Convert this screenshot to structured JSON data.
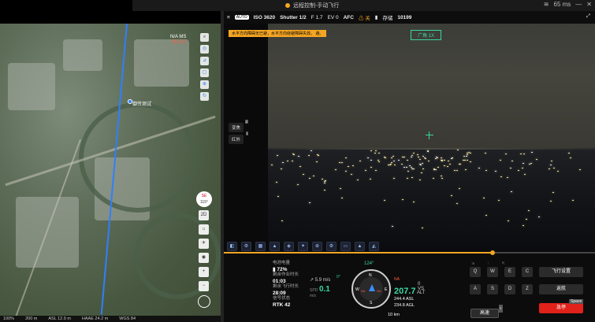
{
  "titlebar": {
    "title": "远程控制-手动飞行",
    "latency": "65 ms",
    "win_controls": [
      "—",
      "✕"
    ]
  },
  "map": {
    "route_label": "御传测试",
    "na_label": "N/A MS",
    "na_label2": "55.1Fs",
    "compass_label": "SE",
    "compass_deg": "115°",
    "tool_2d": "2D",
    "zoom_in": "+",
    "zoom_out": "−",
    "status": {
      "scale": "100%",
      "distance": "200 m",
      "asl": "ASL 12.9 m",
      "haae": "HAAE 24.2 m",
      "wgs": "WGS 84"
    }
  },
  "camera_bar": {
    "iso": "ISO 3620",
    "shutter": "Shutter 1/2",
    "fstop": "F 1.7",
    "ev": "EV 0",
    "af": "AFC",
    "warn_label": "⚠ 关",
    "storage_label": "存储",
    "storage_value": "10199"
  },
  "camera_view": {
    "warning_text": "水平方向障碍无已避，水平方向绕避障碍失效。",
    "warning_extra": "避。",
    "zoom_tag": "广角 1X",
    "btn_change": "变焦",
    "btn_ir": "红外",
    "key_change": "Z",
    "key_ir": "I"
  },
  "camera_tools": [
    "◧",
    "⚙",
    "▦",
    "▲",
    "◈",
    "✦",
    "⊕",
    "⚙",
    "▭",
    "▲",
    "◭"
  ],
  "stats": {
    "battery_label": "电池电量",
    "battery_value": "72%",
    "flytime_label": "剩余作业时长",
    "flytime_value": "01:03",
    "remain_label": "剩余飞行时长",
    "remain_value": "28:09",
    "rtk_label": "信号状态",
    "rtk_value": "RTK 42"
  },
  "flight": {
    "speed_h": "5.9 m/s",
    "spd_label": "SPD",
    "spd_unit": "m/s",
    "spd_value": "0.1",
    "heading": "124°",
    "pitch": "0°",
    "dist": "10 km",
    "vs": "0 VS",
    "alt_label": "ALT",
    "alt_unit": "m",
    "alt_value": "207.7",
    "asl": "244.4 ASL",
    "agl": "234.8 AGL",
    "na": "NA"
  },
  "attitude": {
    "n": "N",
    "s": "S",
    "e": "E",
    "w": "W",
    "na": "NA"
  },
  "keys": {
    "top": [
      "⇲",
      "↑",
      "⇱"
    ],
    "row1": [
      "Q",
      "W",
      "E",
      "C"
    ],
    "row2": [
      "A",
      "S",
      "D",
      "Z"
    ],
    "speed": "高速",
    "speed_key": "⇧"
  },
  "right_buttons": {
    "settings": "飞行设置",
    "rth": "返航",
    "stop": "急停",
    "space": "Space"
  },
  "colors": {
    "accent": "#f5a623",
    "green": "#3ad7a0",
    "blue": "#2f7fff",
    "red": "#e0221a"
  }
}
